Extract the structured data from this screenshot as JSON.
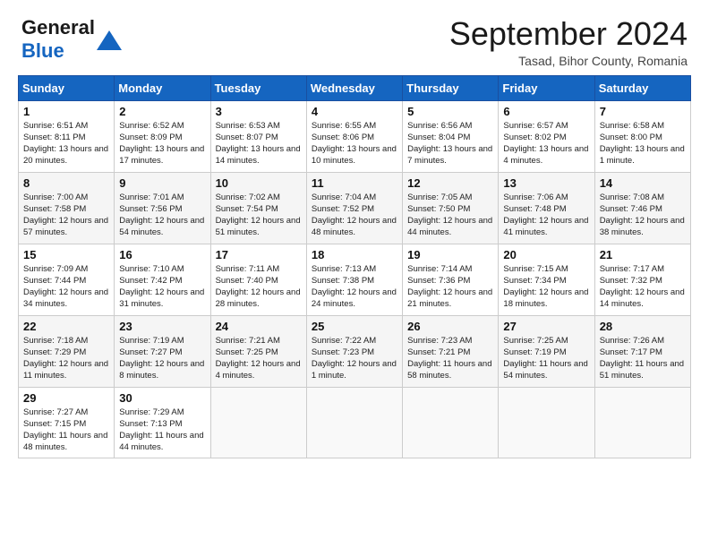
{
  "logo": {
    "general": "General",
    "blue": "Blue"
  },
  "title": "September 2024",
  "location": "Tasad, Bihor County, Romania",
  "days_header": [
    "Sunday",
    "Monday",
    "Tuesday",
    "Wednesday",
    "Thursday",
    "Friday",
    "Saturday"
  ],
  "weeks": [
    [
      {
        "day": "1",
        "sunrise": "Sunrise: 6:51 AM",
        "sunset": "Sunset: 8:11 PM",
        "daylight": "Daylight: 13 hours and 20 minutes."
      },
      {
        "day": "2",
        "sunrise": "Sunrise: 6:52 AM",
        "sunset": "Sunset: 8:09 PM",
        "daylight": "Daylight: 13 hours and 17 minutes."
      },
      {
        "day": "3",
        "sunrise": "Sunrise: 6:53 AM",
        "sunset": "Sunset: 8:07 PM",
        "daylight": "Daylight: 13 hours and 14 minutes."
      },
      {
        "day": "4",
        "sunrise": "Sunrise: 6:55 AM",
        "sunset": "Sunset: 8:06 PM",
        "daylight": "Daylight: 13 hours and 10 minutes."
      },
      {
        "day": "5",
        "sunrise": "Sunrise: 6:56 AM",
        "sunset": "Sunset: 8:04 PM",
        "daylight": "Daylight: 13 hours and 7 minutes."
      },
      {
        "day": "6",
        "sunrise": "Sunrise: 6:57 AM",
        "sunset": "Sunset: 8:02 PM",
        "daylight": "Daylight: 13 hours and 4 minutes."
      },
      {
        "day": "7",
        "sunrise": "Sunrise: 6:58 AM",
        "sunset": "Sunset: 8:00 PM",
        "daylight": "Daylight: 13 hours and 1 minute."
      }
    ],
    [
      {
        "day": "8",
        "sunrise": "Sunrise: 7:00 AM",
        "sunset": "Sunset: 7:58 PM",
        "daylight": "Daylight: 12 hours and 57 minutes."
      },
      {
        "day": "9",
        "sunrise": "Sunrise: 7:01 AM",
        "sunset": "Sunset: 7:56 PM",
        "daylight": "Daylight: 12 hours and 54 minutes."
      },
      {
        "day": "10",
        "sunrise": "Sunrise: 7:02 AM",
        "sunset": "Sunset: 7:54 PM",
        "daylight": "Daylight: 12 hours and 51 minutes."
      },
      {
        "day": "11",
        "sunrise": "Sunrise: 7:04 AM",
        "sunset": "Sunset: 7:52 PM",
        "daylight": "Daylight: 12 hours and 48 minutes."
      },
      {
        "day": "12",
        "sunrise": "Sunrise: 7:05 AM",
        "sunset": "Sunset: 7:50 PM",
        "daylight": "Daylight: 12 hours and 44 minutes."
      },
      {
        "day": "13",
        "sunrise": "Sunrise: 7:06 AM",
        "sunset": "Sunset: 7:48 PM",
        "daylight": "Daylight: 12 hours and 41 minutes."
      },
      {
        "day": "14",
        "sunrise": "Sunrise: 7:08 AM",
        "sunset": "Sunset: 7:46 PM",
        "daylight": "Daylight: 12 hours and 38 minutes."
      }
    ],
    [
      {
        "day": "15",
        "sunrise": "Sunrise: 7:09 AM",
        "sunset": "Sunset: 7:44 PM",
        "daylight": "Daylight: 12 hours and 34 minutes."
      },
      {
        "day": "16",
        "sunrise": "Sunrise: 7:10 AM",
        "sunset": "Sunset: 7:42 PM",
        "daylight": "Daylight: 12 hours and 31 minutes."
      },
      {
        "day": "17",
        "sunrise": "Sunrise: 7:11 AM",
        "sunset": "Sunset: 7:40 PM",
        "daylight": "Daylight: 12 hours and 28 minutes."
      },
      {
        "day": "18",
        "sunrise": "Sunrise: 7:13 AM",
        "sunset": "Sunset: 7:38 PM",
        "daylight": "Daylight: 12 hours and 24 minutes."
      },
      {
        "day": "19",
        "sunrise": "Sunrise: 7:14 AM",
        "sunset": "Sunset: 7:36 PM",
        "daylight": "Daylight: 12 hours and 21 minutes."
      },
      {
        "day": "20",
        "sunrise": "Sunrise: 7:15 AM",
        "sunset": "Sunset: 7:34 PM",
        "daylight": "Daylight: 12 hours and 18 minutes."
      },
      {
        "day": "21",
        "sunrise": "Sunrise: 7:17 AM",
        "sunset": "Sunset: 7:32 PM",
        "daylight": "Daylight: 12 hours and 14 minutes."
      }
    ],
    [
      {
        "day": "22",
        "sunrise": "Sunrise: 7:18 AM",
        "sunset": "Sunset: 7:29 PM",
        "daylight": "Daylight: 12 hours and 11 minutes."
      },
      {
        "day": "23",
        "sunrise": "Sunrise: 7:19 AM",
        "sunset": "Sunset: 7:27 PM",
        "daylight": "Daylight: 12 hours and 8 minutes."
      },
      {
        "day": "24",
        "sunrise": "Sunrise: 7:21 AM",
        "sunset": "Sunset: 7:25 PM",
        "daylight": "Daylight: 12 hours and 4 minutes."
      },
      {
        "day": "25",
        "sunrise": "Sunrise: 7:22 AM",
        "sunset": "Sunset: 7:23 PM",
        "daylight": "Daylight: 12 hours and 1 minute."
      },
      {
        "day": "26",
        "sunrise": "Sunrise: 7:23 AM",
        "sunset": "Sunset: 7:21 PM",
        "daylight": "Daylight: 11 hours and 58 minutes."
      },
      {
        "day": "27",
        "sunrise": "Sunrise: 7:25 AM",
        "sunset": "Sunset: 7:19 PM",
        "daylight": "Daylight: 11 hours and 54 minutes."
      },
      {
        "day": "28",
        "sunrise": "Sunrise: 7:26 AM",
        "sunset": "Sunset: 7:17 PM",
        "daylight": "Daylight: 11 hours and 51 minutes."
      }
    ],
    [
      {
        "day": "29",
        "sunrise": "Sunrise: 7:27 AM",
        "sunset": "Sunset: 7:15 PM",
        "daylight": "Daylight: 11 hours and 48 minutes."
      },
      {
        "day": "30",
        "sunrise": "Sunrise: 7:29 AM",
        "sunset": "Sunset: 7:13 PM",
        "daylight": "Daylight: 11 hours and 44 minutes."
      },
      null,
      null,
      null,
      null,
      null
    ]
  ]
}
